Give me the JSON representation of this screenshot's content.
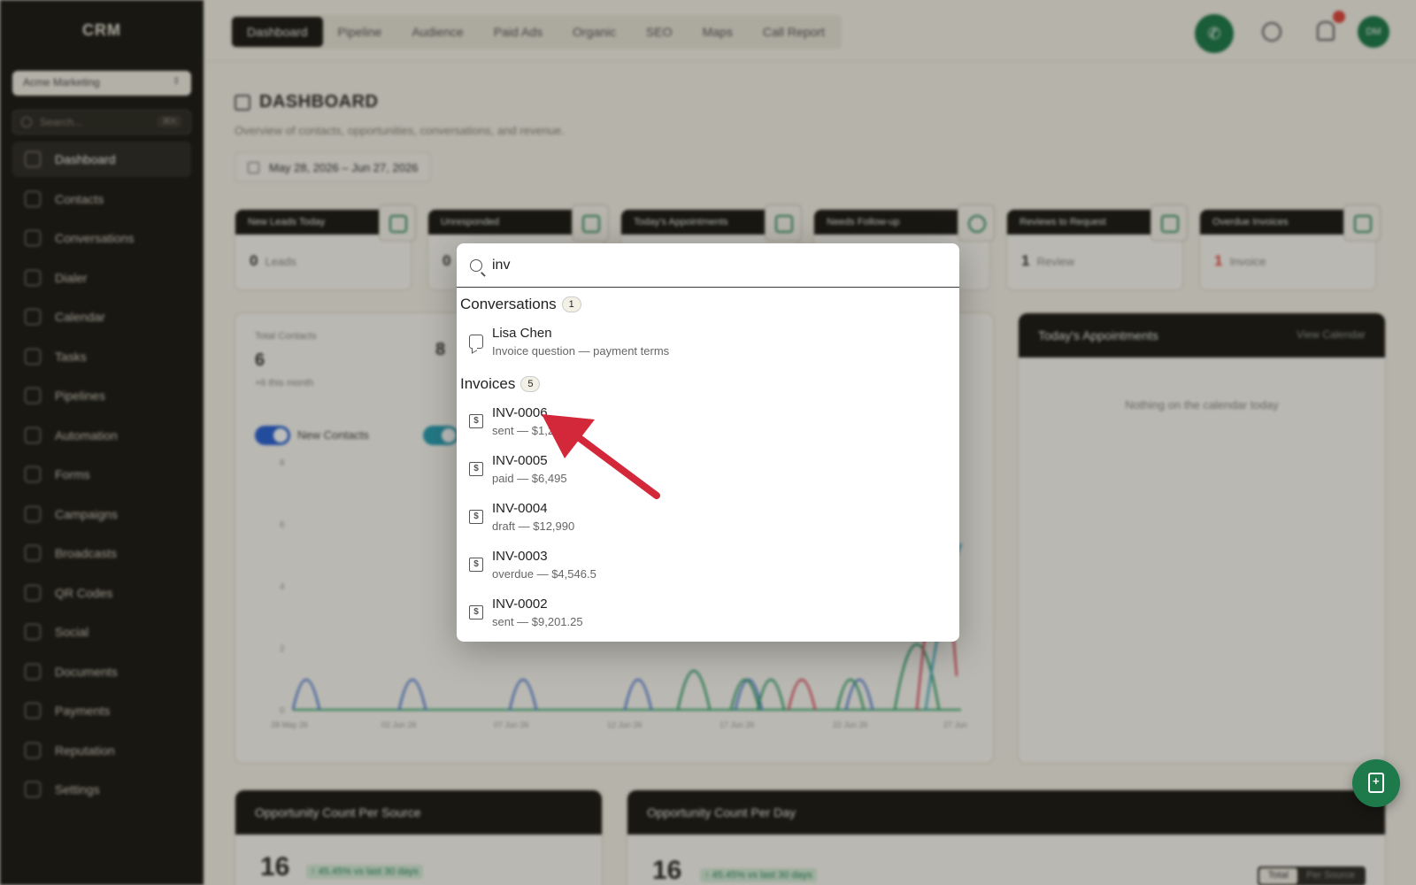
{
  "app": {
    "brand": "CRM"
  },
  "sidebar": {
    "workspace": "Acme Marketing",
    "search_placeholder": "Search...",
    "search_shortcut": "⌘K",
    "items": [
      {
        "label": "Dashboard",
        "icon": "dashboard-icon",
        "active": true
      },
      {
        "label": "Contacts",
        "icon": "contacts-icon"
      },
      {
        "label": "Conversations",
        "icon": "chat-icon"
      },
      {
        "label": "Dialer",
        "icon": "phone-icon"
      },
      {
        "label": "Calendar",
        "icon": "calendar-icon"
      },
      {
        "label": "Tasks",
        "icon": "folder-icon"
      },
      {
        "label": "Pipelines",
        "icon": "pipeline-icon"
      },
      {
        "label": "Automation",
        "icon": "automation-icon"
      },
      {
        "label": "Forms",
        "icon": "form-icon"
      },
      {
        "label": "Campaigns",
        "icon": "mail-icon"
      },
      {
        "label": "Broadcasts",
        "icon": "broadcast-icon"
      },
      {
        "label": "QR Codes",
        "icon": "qr-icon"
      },
      {
        "label": "Social",
        "icon": "share-icon"
      },
      {
        "label": "Documents",
        "icon": "document-icon"
      },
      {
        "label": "Payments",
        "icon": "invoice-icon"
      },
      {
        "label": "Reputation",
        "icon": "star-icon"
      },
      {
        "label": "Settings",
        "icon": "gear-icon"
      }
    ]
  },
  "topbar": {
    "tabs": [
      "Dashboard",
      "Pipeline",
      "Audience",
      "Paid Ads",
      "Organic",
      "SEO",
      "Maps",
      "Call Report"
    ],
    "active_tab": "Dashboard",
    "avatar_initials": "DM"
  },
  "page": {
    "title": "DASHBOARD",
    "subtitle": "Overview of contacts, opportunities, conversations, and revenue.",
    "date_range": "May 28, 2026 – Jun 27, 2026"
  },
  "stat_cards": [
    {
      "title": "New Leads Today",
      "value": "0",
      "unit": "Leads"
    },
    {
      "title": "Unresponded",
      "value": "0",
      "unit": ""
    },
    {
      "title": "Today's Appointments",
      "value": "",
      "unit": ""
    },
    {
      "title": "Needs Follow-up",
      "value": "",
      "unit": ""
    },
    {
      "title": "Reviews to Request",
      "value": "1",
      "unit": "Review"
    },
    {
      "title": "Overdue Invoices",
      "value": "1",
      "unit": "Invoice"
    }
  ],
  "contacts_panel": {
    "total_label": "Total Contacts",
    "total_value": "6",
    "total_note": "+6 this month",
    "second_value": "8",
    "toggle_label": "New Contacts",
    "y_ticks": [
      "8",
      "6",
      "4",
      "2",
      "0"
    ],
    "x_ticks": [
      "28 May 26",
      "02 Jun 26",
      "07 Jun 26",
      "12 Jun 26",
      "17 Jun 26",
      "22 Jun 26",
      "27 Jun"
    ]
  },
  "appointments_panel": {
    "title": "Today's Appointments",
    "link": "View Calendar",
    "empty": "Nothing on the calendar today"
  },
  "opp_source": {
    "title": "Opportunity Count Per Source",
    "value": "16",
    "delta": "↑ 45.45% vs last 30 days"
  },
  "opp_day": {
    "title": "Opportunity Count Per Day",
    "value": "16",
    "delta": "↑ 45.45% vs last 30 days",
    "seg": [
      "Total",
      "Per Source"
    ]
  },
  "palette": {
    "query": "inv",
    "groups": [
      {
        "name": "Conversations",
        "count": "1",
        "results": [
          {
            "title": "Lisa Chen",
            "subtitle": "Invoice question — payment terms",
            "icon": "chat-icon"
          }
        ]
      },
      {
        "name": "Invoices",
        "count": "5",
        "results": [
          {
            "title": "INV-0006",
            "subtitle": "sent — $1,234.25",
            "icon": "invoice-icon"
          },
          {
            "title": "INV-0005",
            "subtitle": "paid — $6,495",
            "icon": "invoice-icon"
          },
          {
            "title": "INV-0004",
            "subtitle": "draft — $12,990",
            "icon": "invoice-icon"
          },
          {
            "title": "INV-0003",
            "subtitle": "overdue — $4,546.5",
            "icon": "invoice-icon"
          },
          {
            "title": "INV-0002",
            "subtitle": "sent — $9,201.25",
            "icon": "invoice-icon"
          }
        ]
      }
    ]
  },
  "colors": {
    "accent": "#1e7a4b",
    "sidebar_bg": "#1b1a15",
    "arrow": "#d3283a",
    "alert": "#e0463d"
  }
}
